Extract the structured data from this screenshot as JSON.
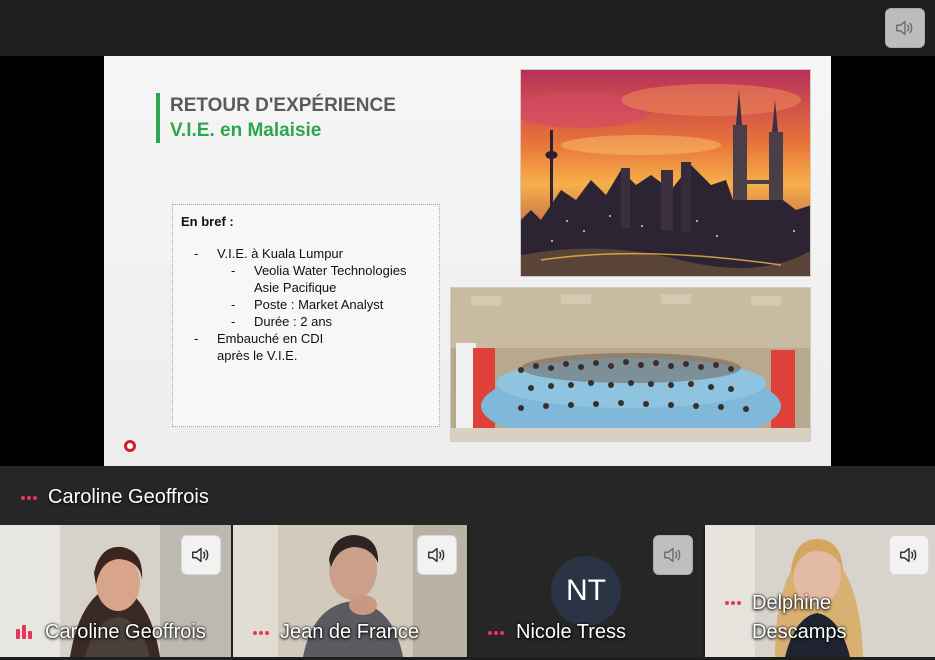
{
  "slide": {
    "title_line1": "RETOUR D'EXPÉRIENCE",
    "title_line2": "V.I.E. en Malaisie",
    "brief_heading": "En bref :",
    "bullets": [
      "V.I.E. à Kuala Lumpur",
      "Veolia Water Technologies",
      "Asie Pacifique",
      "Poste : Market Analyst",
      "Durée : 2 ans",
      "Embauché en CDI",
      "après le V.I.E."
    ]
  },
  "active_speaker": {
    "name": "Caroline Geoffrois"
  },
  "participants": [
    {
      "name": "Caroline Geoffrois"
    },
    {
      "name": "Jean de France"
    },
    {
      "name": "Nicole Tress",
      "initials": "NT"
    },
    {
      "name_line1": "Delphine",
      "name_line2": "Descamps"
    }
  ],
  "icons": {
    "speaker": "speaker-icon",
    "more": "more-dots-icon",
    "mic_active": "mic-activity-icon"
  },
  "colors": {
    "accent_green": "#2ea64f",
    "dots_red": "#e8365a",
    "background": "#1e1e1e"
  }
}
